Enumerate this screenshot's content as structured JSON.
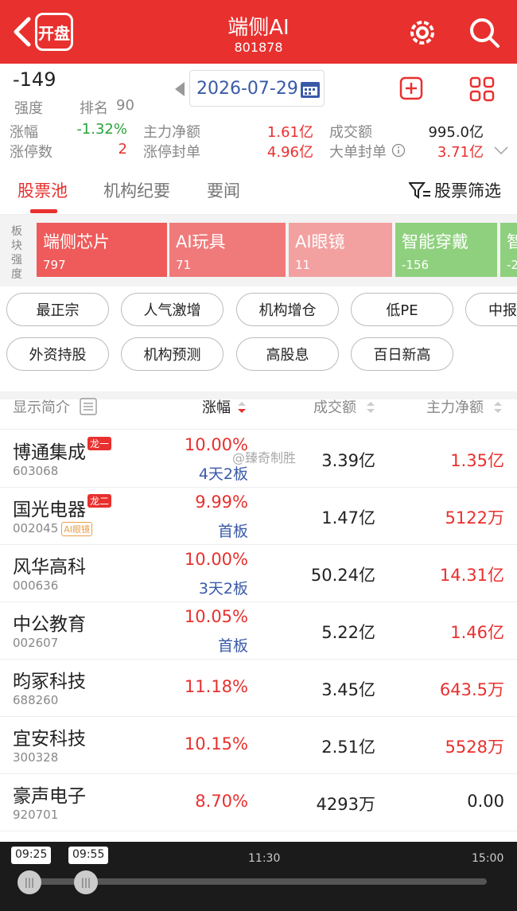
{
  "header": {
    "logo": "开盘",
    "title": "端侧AI",
    "code": "801878"
  },
  "summary": {
    "strength_value": "-149",
    "strength_label": "强度",
    "rank_label": "排名",
    "rank_value": "90",
    "date": "2026-07-29",
    "stats": [
      {
        "label": "涨幅",
        "value": "-1.32%"
      },
      {
        "label": "涨停数",
        "value": "2"
      },
      {
        "label": "主力净额",
        "value": "1.61亿"
      },
      {
        "label": "涨停封单",
        "value": "4.96亿"
      },
      {
        "label": "成交额",
        "value": "995.0亿"
      },
      {
        "label": "大单封单",
        "value": "3.71亿"
      }
    ]
  },
  "tabs": {
    "items": [
      "股票池",
      "机构纪要",
      "要闻"
    ],
    "filter": "股票筛选"
  },
  "sectors": {
    "side_label": "板块强度",
    "items": [
      {
        "name": "端侧芯片",
        "count": "797",
        "color": "#ef5a5a"
      },
      {
        "name": "AI玩具",
        "count": "71",
        "color": "#f07a7a"
      },
      {
        "name": "AI眼镜",
        "count": "11",
        "color": "#f3a0a0"
      },
      {
        "name": "智能穿戴",
        "count": "-156",
        "color": "#8fd07e"
      },
      {
        "name": "智",
        "count": "-2",
        "color": "#8fd07e"
      }
    ]
  },
  "chips": [
    "最正宗",
    "人气激增",
    "机构增仓",
    "低PE",
    "中报",
    "外资持股",
    "机构预测",
    "高股息",
    "百日新高"
  ],
  "table": {
    "headers": [
      "显示简介",
      "涨幅",
      "成交额",
      "主力净额"
    ],
    "watermark": "@臻奇制胜",
    "rows": [
      {
        "name": "博通集成",
        "badge": "龙一",
        "code": "603068",
        "tag": "",
        "pct": "10.00%",
        "sub": "4天2板",
        "amount": "3.39亿",
        "net": "1.35亿",
        "net_color": "#e8302e"
      },
      {
        "name": "国光电器",
        "badge": "龙二",
        "code": "002045",
        "tag": "AI眼镜",
        "pct": "9.99%",
        "sub": "首板",
        "amount": "1.47亿",
        "net": "5122万",
        "net_color": "#e8302e"
      },
      {
        "name": "风华高科",
        "badge": "",
        "code": "000636",
        "tag": "",
        "pct": "10.00%",
        "sub": "3天2板",
        "amount": "50.24亿",
        "net": "14.31亿",
        "net_color": "#e8302e"
      },
      {
        "name": "中公教育",
        "badge": "",
        "code": "002607",
        "tag": "",
        "pct": "10.05%",
        "sub": "首板",
        "amount": "5.22亿",
        "net": "1.46亿",
        "net_color": "#e8302e"
      },
      {
        "name": "昀冢科技",
        "badge": "",
        "code": "688260",
        "tag": "",
        "pct": "11.18%",
        "sub": "",
        "amount": "3.45亿",
        "net": "643.5万",
        "net_color": "#e8302e"
      },
      {
        "name": "宜安科技",
        "badge": "",
        "code": "300328",
        "tag": "",
        "pct": "10.15%",
        "sub": "",
        "amount": "2.51亿",
        "net": "5528万",
        "net_color": "#e8302e"
      },
      {
        "name": "豪声电子",
        "badge": "",
        "code": "920701",
        "tag": "",
        "pct": "8.70%",
        "sub": "",
        "amount": "4293万",
        "net": "0.00",
        "net_color": "#222222"
      }
    ]
  },
  "timeline": {
    "start": "09:25",
    "current": "09:55",
    "mid": "11:30",
    "end": "15:00"
  }
}
